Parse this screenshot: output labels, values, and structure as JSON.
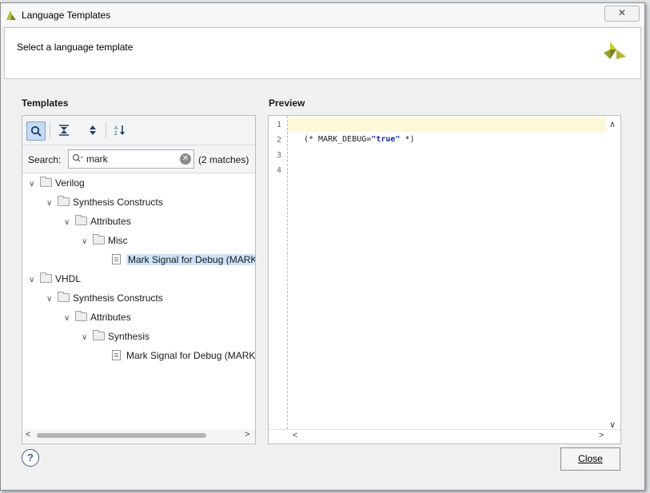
{
  "window": {
    "title": "Language Templates",
    "close_label": "✕✕"
  },
  "header": {
    "prompt": "Select a language template"
  },
  "templates": {
    "label": "Templates",
    "search": {
      "label": "Search:",
      "value": "mark",
      "matches": "(2 matches)"
    },
    "tree": [
      {
        "label": "Verilog"
      },
      {
        "label": "Synthesis Constructs"
      },
      {
        "label": "Attributes"
      },
      {
        "label": "Misc"
      },
      {
        "label": "Mark Signal for Debug (MARK"
      },
      {
        "label": "VHDL"
      },
      {
        "label": "Synthesis Constructs"
      },
      {
        "label": "Attributes"
      },
      {
        "label": "Synthesis"
      },
      {
        "label": "Mark Signal for Debug (MARK"
      }
    ]
  },
  "preview": {
    "label": "Preview",
    "line_numbers": [
      "1",
      "2",
      "3",
      "4"
    ],
    "code_prefix": "(* MARK_DEBUG=",
    "code_string": "\"true\"",
    "code_suffix": " *)"
  },
  "footer": {
    "help": "?",
    "close": "Close"
  },
  "colors": {
    "accent_logo": "#9aa02a",
    "selection": "#cde3f7",
    "highlight_line": "#fcf8d8"
  }
}
